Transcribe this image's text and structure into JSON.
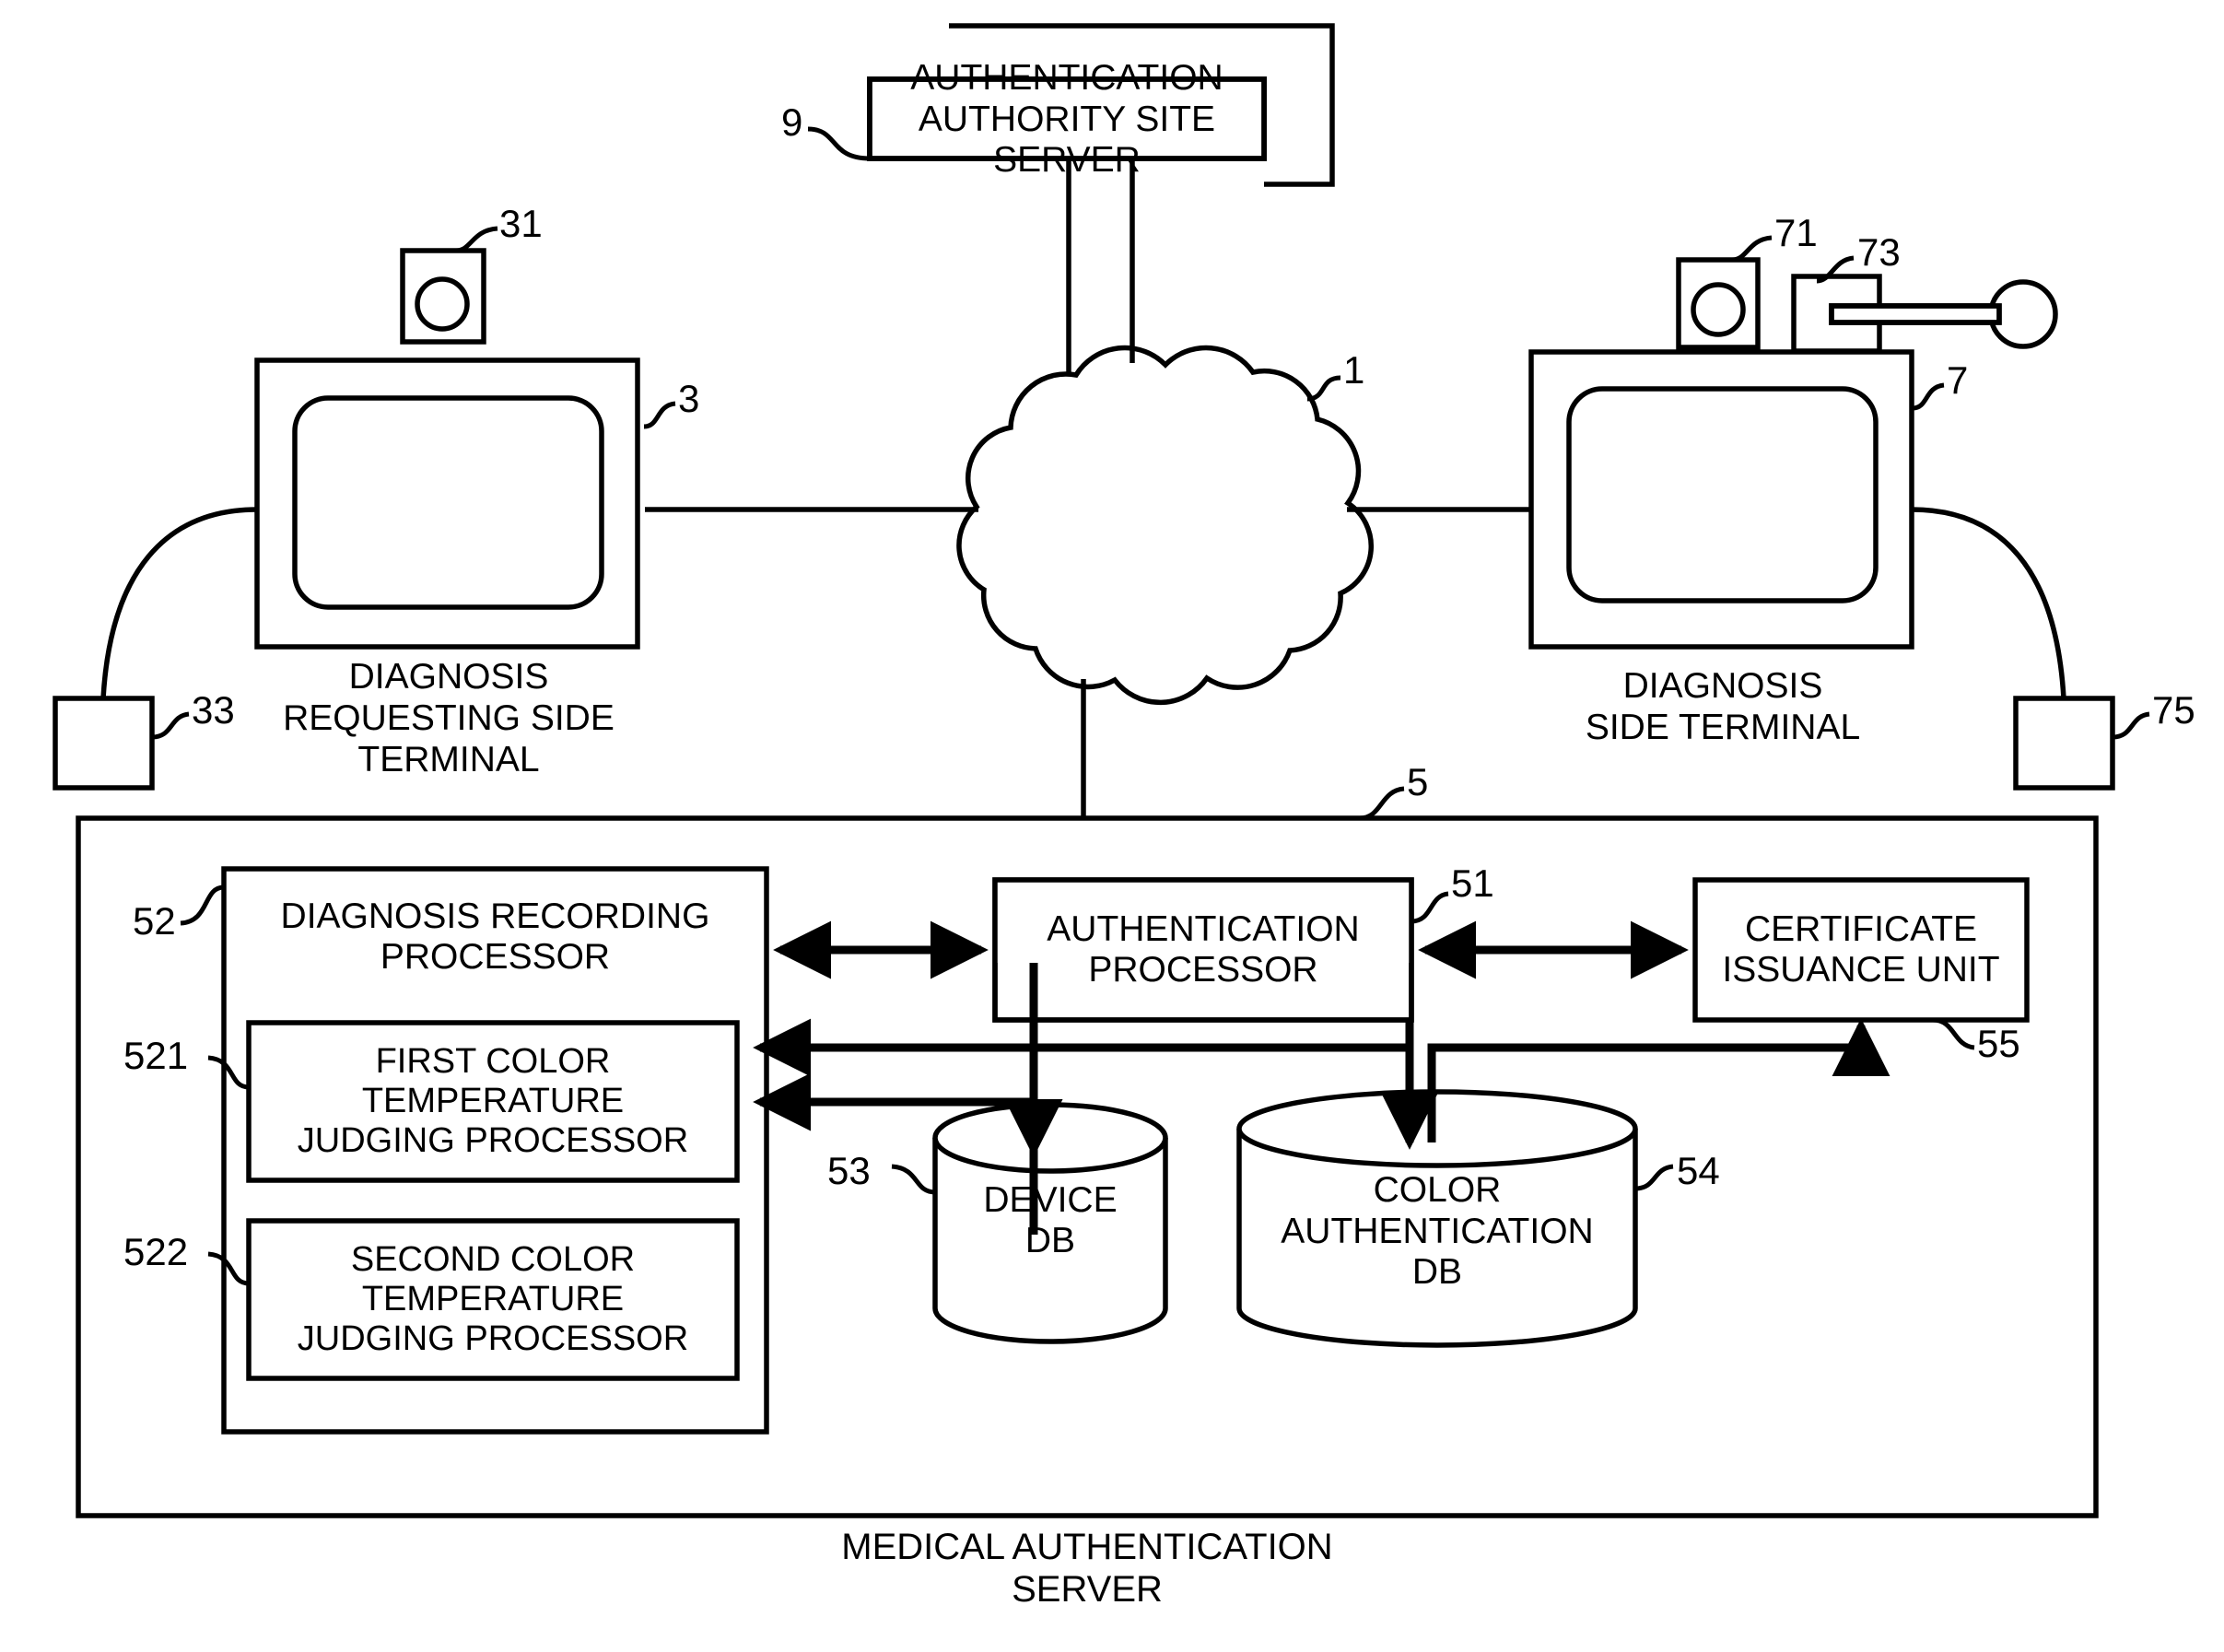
{
  "figure": {
    "title_caption": "MEDICAL AUTHENTICATION\nSERVER",
    "ink_color": "#000000",
    "background_color": "#ffffff"
  },
  "network": {
    "cloud_ref": "1"
  },
  "nodes": {
    "auth_authority_server": {
      "label": "AUTHENTICATION\nAUTHORITY SITE\nSERVER",
      "ref": "9"
    },
    "requesting_terminal": {
      "label": "DIAGNOSIS\nREQUESTING SIDE\nTERMINAL",
      "ref": "3",
      "camera_ref": "31",
      "peripheral_ref": "33"
    },
    "diagnosis_terminal": {
      "label": "DIAGNOSIS\nSIDE TERMINAL",
      "ref": "7",
      "camera_ref": "71",
      "card_reader_ref": "73",
      "peripheral_ref": "75"
    },
    "medical_server": {
      "ref": "5"
    }
  },
  "server_blocks": {
    "diagnosis_recording_processor": {
      "label": "DIAGNOSIS RECORDING\nPROCESSOR",
      "ref": "52"
    },
    "first_color_temp_processor": {
      "label": "FIRST COLOR\nTEMPERATURE\nJUDGING PROCESSOR",
      "ref": "521"
    },
    "second_color_temp_processor": {
      "label": "SECOND COLOR\nTEMPERATURE\nJUDGING PROCESSOR",
      "ref": "522"
    },
    "authentication_processor": {
      "label": "AUTHENTICATION\nPROCESSOR",
      "ref": "51"
    },
    "certificate_issuance_unit": {
      "label": "CERTIFICATE\nISSUANCE UNIT",
      "ref": "55"
    },
    "device_db": {
      "label": "DEVICE\nDB",
      "ref": "53"
    },
    "color_authentication_db": {
      "label": "COLOR\nAUTHENTICATION\nDB",
      "ref": "54"
    }
  }
}
